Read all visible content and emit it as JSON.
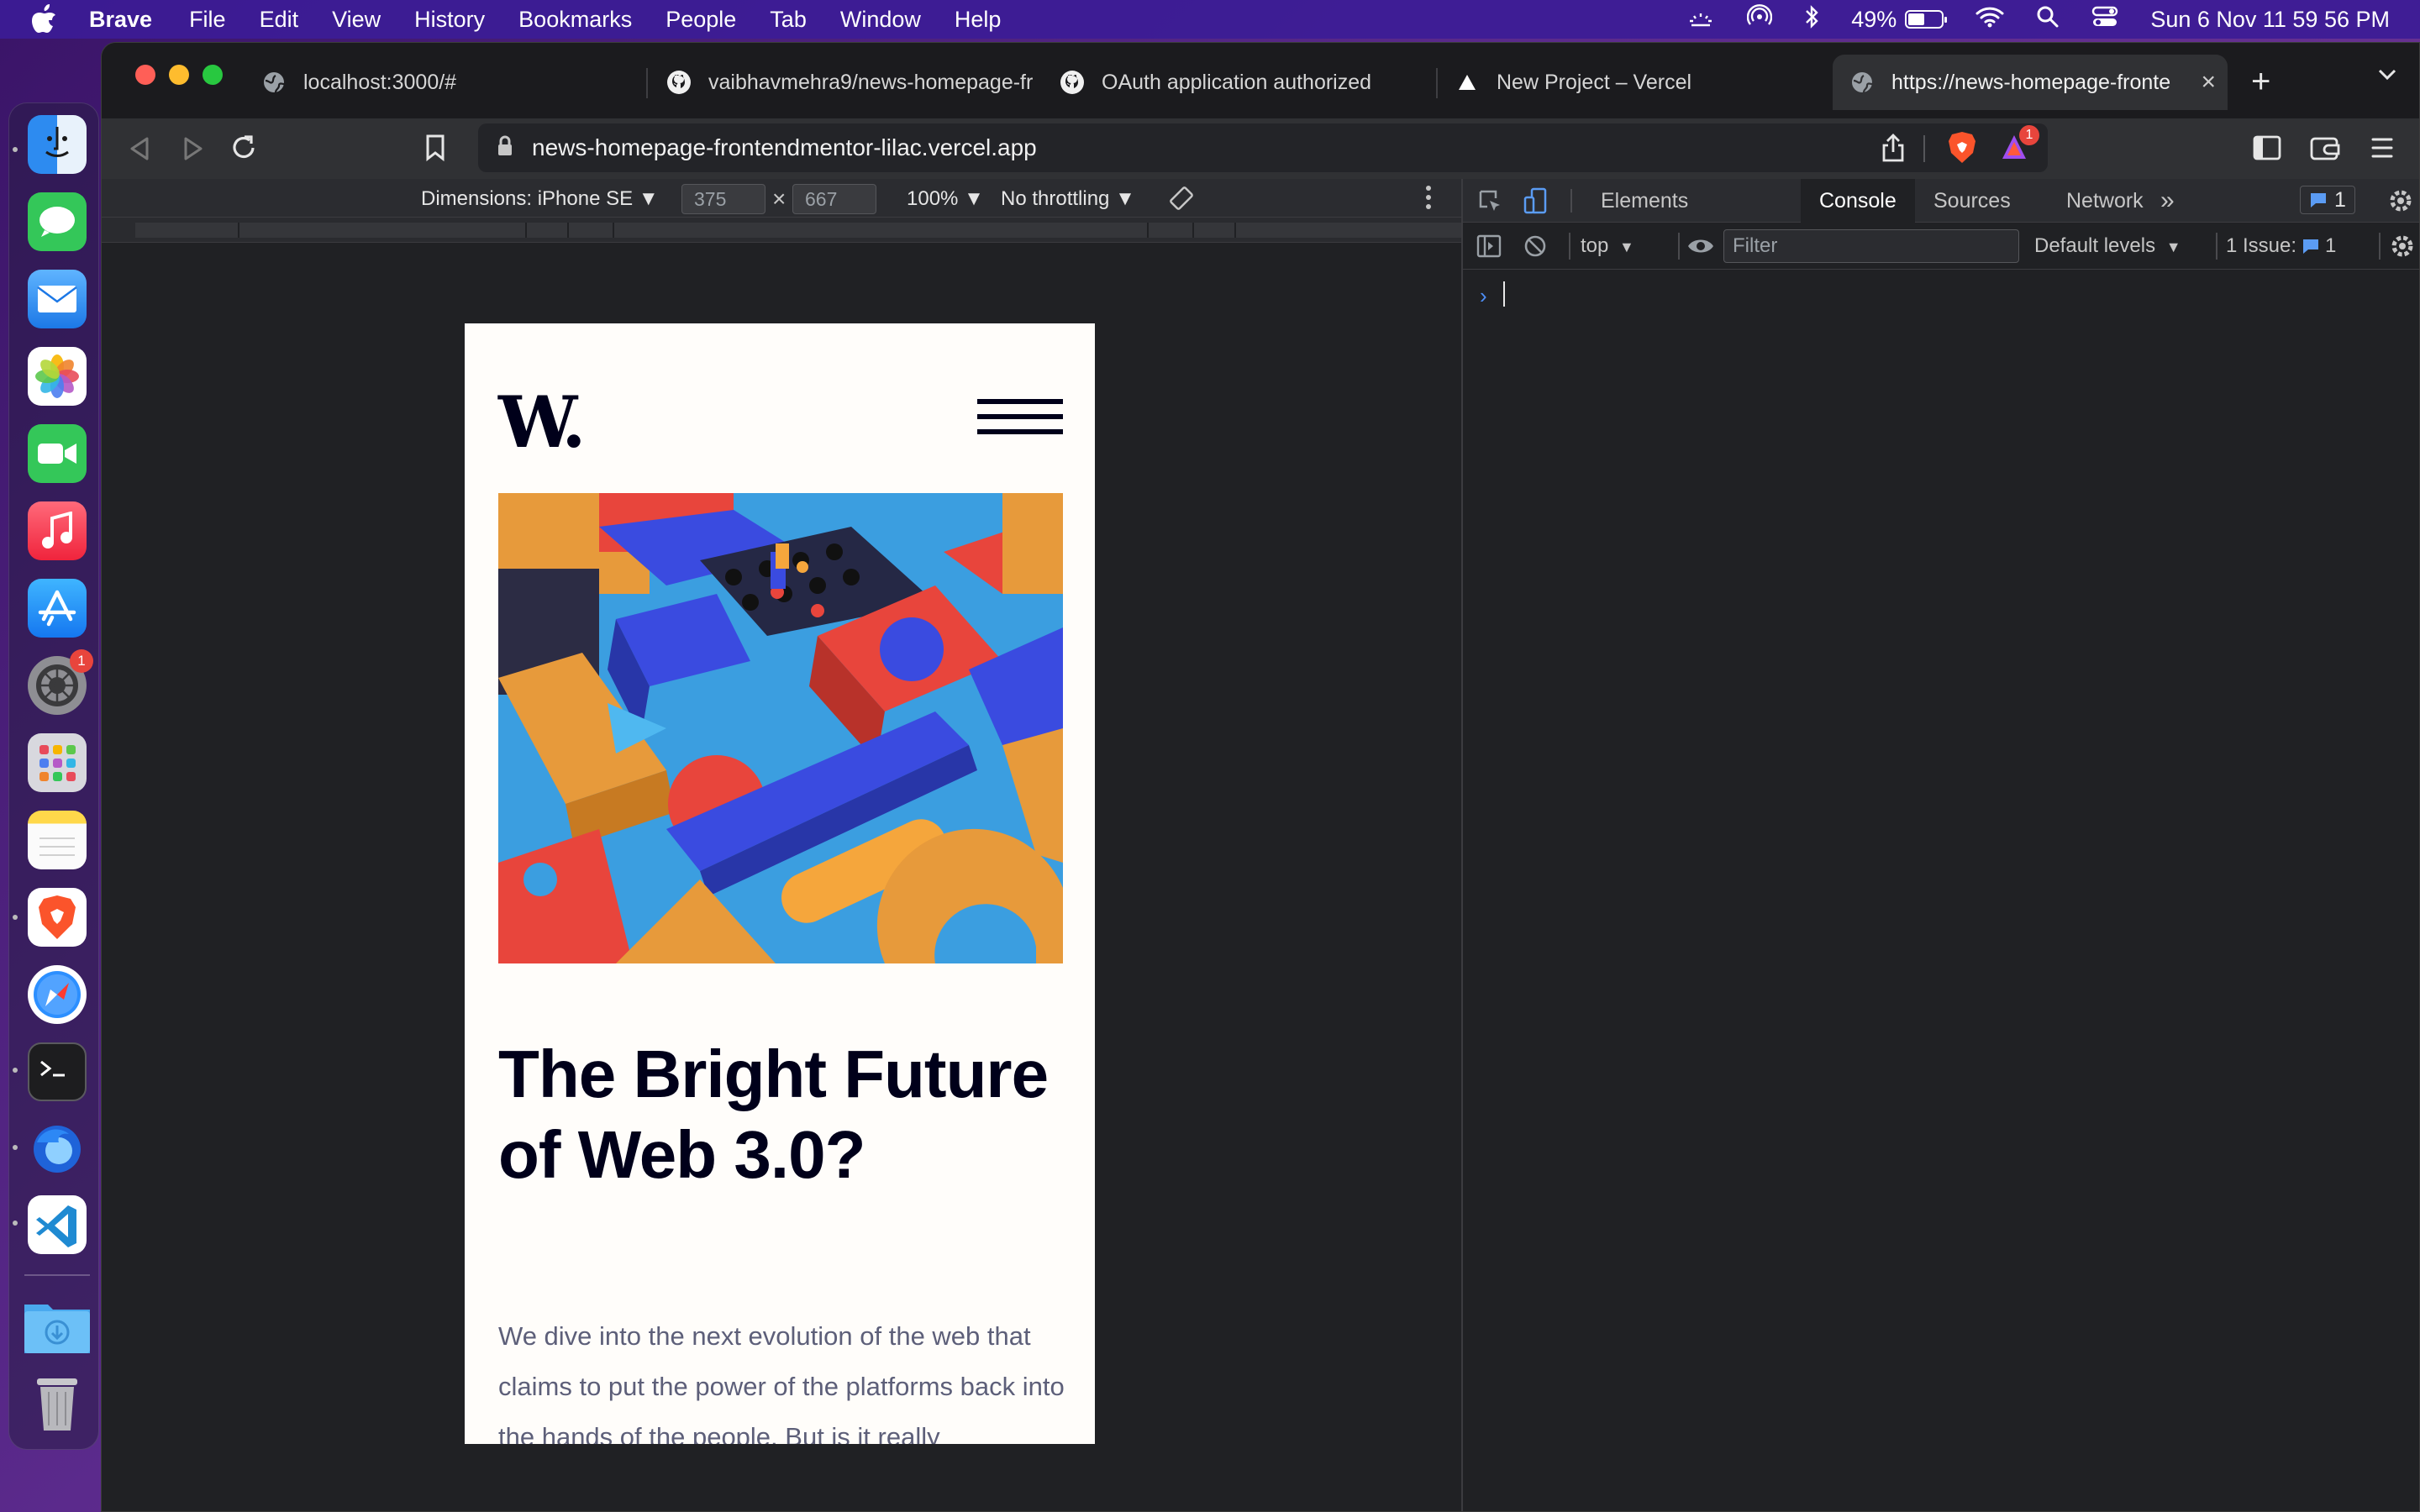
{
  "menubar": {
    "app_name": "Brave",
    "items": [
      "File",
      "Edit",
      "View",
      "History",
      "Bookmarks",
      "People",
      "Tab",
      "Window",
      "Help"
    ],
    "battery": "49%",
    "datetime": "Sun 6 Nov  11 59 56 PM",
    "battery_level": 0.49
  },
  "dock": {
    "apps": [
      "finder",
      "messages",
      "mail",
      "photos",
      "facetime",
      "music",
      "app-store",
      "system-preferences",
      "launchpad",
      "notes",
      "brave",
      "safari",
      "terminal",
      "firefox",
      "vscode",
      "downloads",
      "trash"
    ],
    "system_preferences_badge": "1"
  },
  "browser": {
    "tabs": [
      {
        "title": "localhost:3000/#",
        "icon": "globe-icon"
      },
      {
        "title": "vaibhavmehra9/news-homepage-fr",
        "icon": "github-icon"
      },
      {
        "title": "OAuth application authorized",
        "icon": "github-icon"
      },
      {
        "title": "New Project – Vercel",
        "icon": "vercel-icon"
      },
      {
        "title": "https://news-homepage-fronte",
        "icon": "globe-icon"
      }
    ],
    "url": "news-homepage-frontendmentor-lilac.vercel.app",
    "rewards_badge": "1"
  },
  "device_toolbar": {
    "dimensions_label": "Dimensions: iPhone SE",
    "width": "375",
    "height": "667",
    "times": "×",
    "zoom": "100%",
    "throttling": "No throttling"
  },
  "page": {
    "logo": "W.",
    "headline": "The Bright Future of Web 3.0?",
    "body": "We dive into the next evolution of the web that claims to put the power of the platforms back into the hands of the people. But is it really"
  },
  "devtools": {
    "tabs": [
      "Elements",
      "Console",
      "Sources",
      "Network"
    ],
    "active_tab": "Console",
    "more": "»",
    "message_count": "1",
    "context": "top",
    "filter_placeholder": "Filter",
    "levels": "Default levels",
    "issues_label": "1 Issue:",
    "issues_count": "1",
    "prompt": "›"
  },
  "colors": {
    "menubar": "#3c1c96",
    "devtools_bg": "#202124",
    "console_prompt": "#4d8ef7",
    "headline": "#00001a",
    "body_text": "#5d5f79"
  }
}
